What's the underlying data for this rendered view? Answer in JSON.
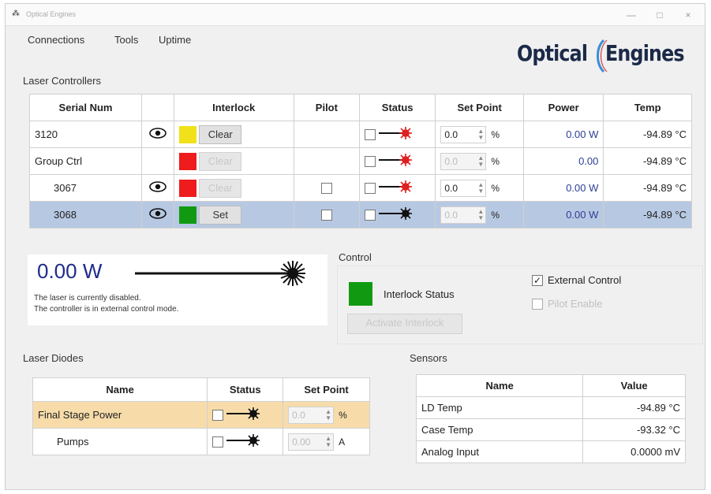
{
  "window": {
    "title": "Optical Engines",
    "min": "—",
    "max": "□",
    "close": "×"
  },
  "menu": [
    "Connections",
    "Tools",
    "Uptime"
  ],
  "logo": {
    "word1": "Optical",
    "word2": "Engines"
  },
  "laser_controllers": {
    "label": "Laser Controllers",
    "columns": [
      "Serial Num",
      "",
      "Interlock",
      "Pilot",
      "Status",
      "Set Point",
      "Power",
      "Temp"
    ],
    "rows": [
      {
        "serial": "3120",
        "eye": true,
        "interlock_color": "#f0e11a",
        "button": "Clear",
        "button_enabled": true,
        "pilot": "",
        "setpoint": "0.0",
        "setpoint_enabled": true,
        "unit": "%",
        "power": "0.00 W",
        "temp": "-94.89 °C",
        "laser_color": "#e02020"
      },
      {
        "serial": "Group Ctrl",
        "eye": false,
        "interlock_color": "#ee1c1c",
        "button": "Clear",
        "button_enabled": false,
        "pilot": "",
        "setpoint": "0.0",
        "setpoint_enabled": false,
        "unit": "%",
        "power": "0.00",
        "temp": "-94.89 °C",
        "laser_color": "#e02020"
      },
      {
        "serial": "3067",
        "eye": true,
        "interlock_color": "#ee1c1c",
        "button": "Clear",
        "button_enabled": false,
        "pilot": "checkbox",
        "setpoint": "0.0",
        "setpoint_enabled": true,
        "unit": "%",
        "power": "0.00 W",
        "temp": "-94.89 °C",
        "laser_color": "#e02020"
      },
      {
        "serial": "3068",
        "eye": true,
        "interlock_color": "#119a11",
        "button": "Set",
        "button_enabled": true,
        "pilot": "checkbox",
        "setpoint": "0.0",
        "setpoint_enabled": false,
        "unit": "%",
        "power": "0.00 W",
        "temp": "-94.89 °C",
        "laser_color": "#111111"
      }
    ]
  },
  "power_panel": {
    "value": "0.00 W",
    "msg1": "The laser is currently disabled.",
    "msg2": "The controller is in external control mode."
  },
  "control": {
    "label": "Control",
    "interlock_status": "Interlock Status",
    "interlock_color": "#119a11",
    "activate_button": "Activate Interlock",
    "external_control": "External Control",
    "pilot_enable": "Pilot Enable"
  },
  "laser_diodes": {
    "label": "Laser Diodes",
    "columns": [
      "Name",
      "Status",
      "Set Point"
    ],
    "rows": [
      {
        "name": "Final Stage Power",
        "setpoint": "0.0",
        "unit": "%"
      },
      {
        "name": "Pumps",
        "setpoint": "0.00",
        "unit": "A"
      }
    ]
  },
  "sensors": {
    "label": "Sensors",
    "columns": [
      "Name",
      "Value"
    ],
    "rows": [
      {
        "name": "LD Temp",
        "value": "-94.89 °C"
      },
      {
        "name": "Case Temp",
        "value": "-93.32 °C"
      },
      {
        "name": "Analog Input",
        "value": "0.0000 mV"
      }
    ]
  }
}
